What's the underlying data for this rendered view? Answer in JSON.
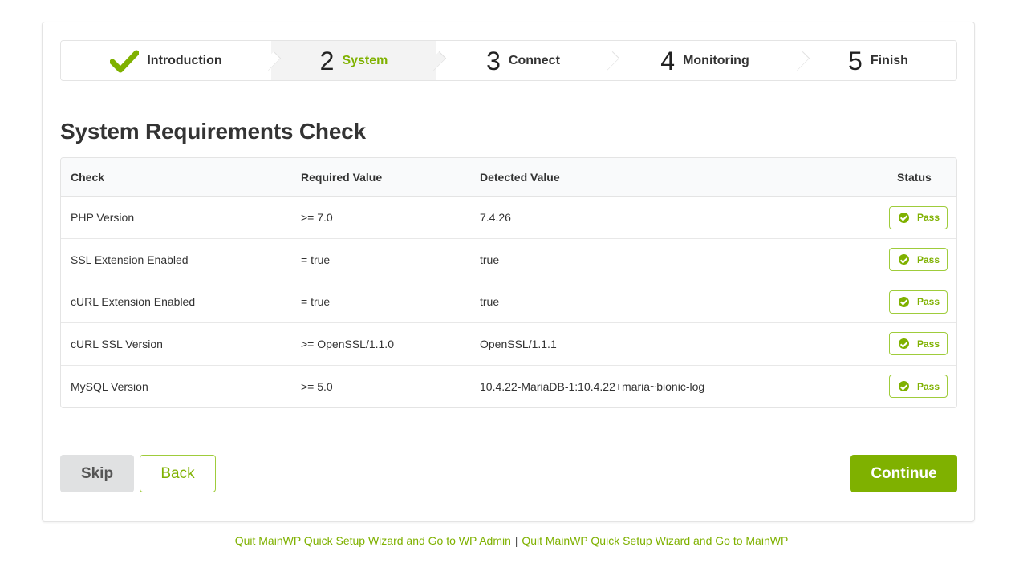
{
  "steps": [
    {
      "number": "",
      "label": "Introduction",
      "state": "done",
      "icon": "checkmark-icon"
    },
    {
      "number": "2",
      "label": "System",
      "state": "active"
    },
    {
      "number": "3",
      "label": "Connect",
      "state": "pending"
    },
    {
      "number": "4",
      "label": "Monitoring",
      "state": "pending"
    },
    {
      "number": "5",
      "label": "Finish",
      "state": "pending"
    }
  ],
  "page": {
    "title": "System Requirements Check"
  },
  "table": {
    "headers": {
      "check": "Check",
      "required": "Required Value",
      "detected": "Detected Value",
      "status": "Status"
    },
    "rows": [
      {
        "check": "PHP Version",
        "required": ">= 7.0",
        "detected": "7.4.26",
        "status": "Pass"
      },
      {
        "check": "SSL Extension Enabled",
        "required": "= true",
        "detected": "true",
        "status": "Pass"
      },
      {
        "check": "cURL Extension Enabled",
        "required": "= true",
        "detected": "true",
        "status": "Pass"
      },
      {
        "check": "cURL SSL Version",
        "required": ">= OpenSSL/1.1.0",
        "detected": "OpenSSL/1.1.1",
        "status": "Pass"
      },
      {
        "check": "MySQL Version",
        "required": ">= 5.0",
        "detected": "10.4.22-MariaDB-1:10.4.22+maria~bionic-log",
        "status": "Pass"
      }
    ]
  },
  "buttons": {
    "skip": "Skip",
    "back": "Back",
    "continue": "Continue"
  },
  "footer": {
    "link_wp_admin": "Quit MainWP Quick Setup Wizard and Go to WP Admin",
    "separator": "|",
    "link_mainwp": "Quit MainWP Quick Setup Wizard and Go to MainWP"
  },
  "colors": {
    "accent": "#7fb100",
    "badge_border": "#9fcc3b",
    "skip_bg": "#e0e1e2"
  }
}
